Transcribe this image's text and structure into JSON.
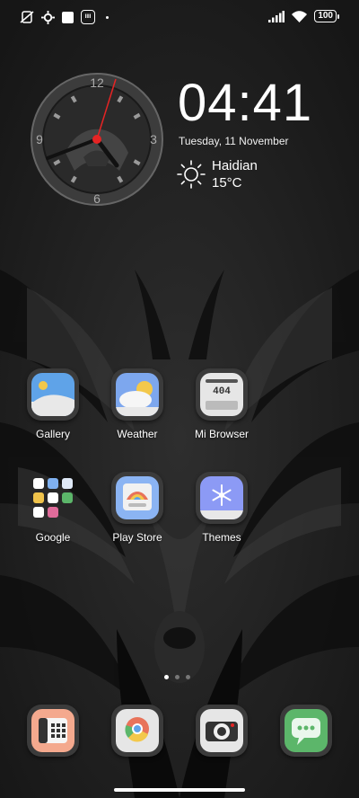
{
  "status_bar": {
    "icons_left": [
      "no-sim-icon",
      "settings-gear-icon",
      "notification-square-icon",
      "app-badge-icon",
      "dot-icon"
    ],
    "app_badge_text": "IIII",
    "icons_right": [
      "signal-icon",
      "wifi-icon",
      "battery-icon"
    ],
    "battery": "100"
  },
  "clock_widget": {
    "dial_numbers": {
      "n12": "12",
      "n3": "3",
      "n6": "6",
      "n9": "9"
    },
    "time": "04:41",
    "date": "Tuesday, 11 November",
    "city": "Haidian",
    "temperature": "15°C",
    "weather_icon": "sun-icon"
  },
  "apps": {
    "gallery": {
      "label": "Gallery",
      "icon": "gallery-icon"
    },
    "weather": {
      "label": "Weather",
      "icon": "weather-icon"
    },
    "mi_browser": {
      "label": "Mi Browser",
      "icon": "browser-icon",
      "icon_text": "404"
    },
    "google": {
      "label": "Google",
      "icon": "google-folder-icon"
    },
    "play_store": {
      "label": "Play Store",
      "icon": "play-store-icon"
    },
    "themes": {
      "label": "Themes",
      "icon": "themes-icon"
    }
  },
  "dock": [
    "phone-icon",
    "chrome-icon",
    "camera-icon",
    "messages-icon"
  ],
  "page_indicator": {
    "pages": 3,
    "active": 1
  },
  "colors": {
    "accent_red": "#e52424",
    "gallery_blue": "#5fa3e8",
    "themes_purple": "#8c9af5",
    "messages_green": "#5cb66a",
    "phone_peach": "#f4a98e"
  }
}
